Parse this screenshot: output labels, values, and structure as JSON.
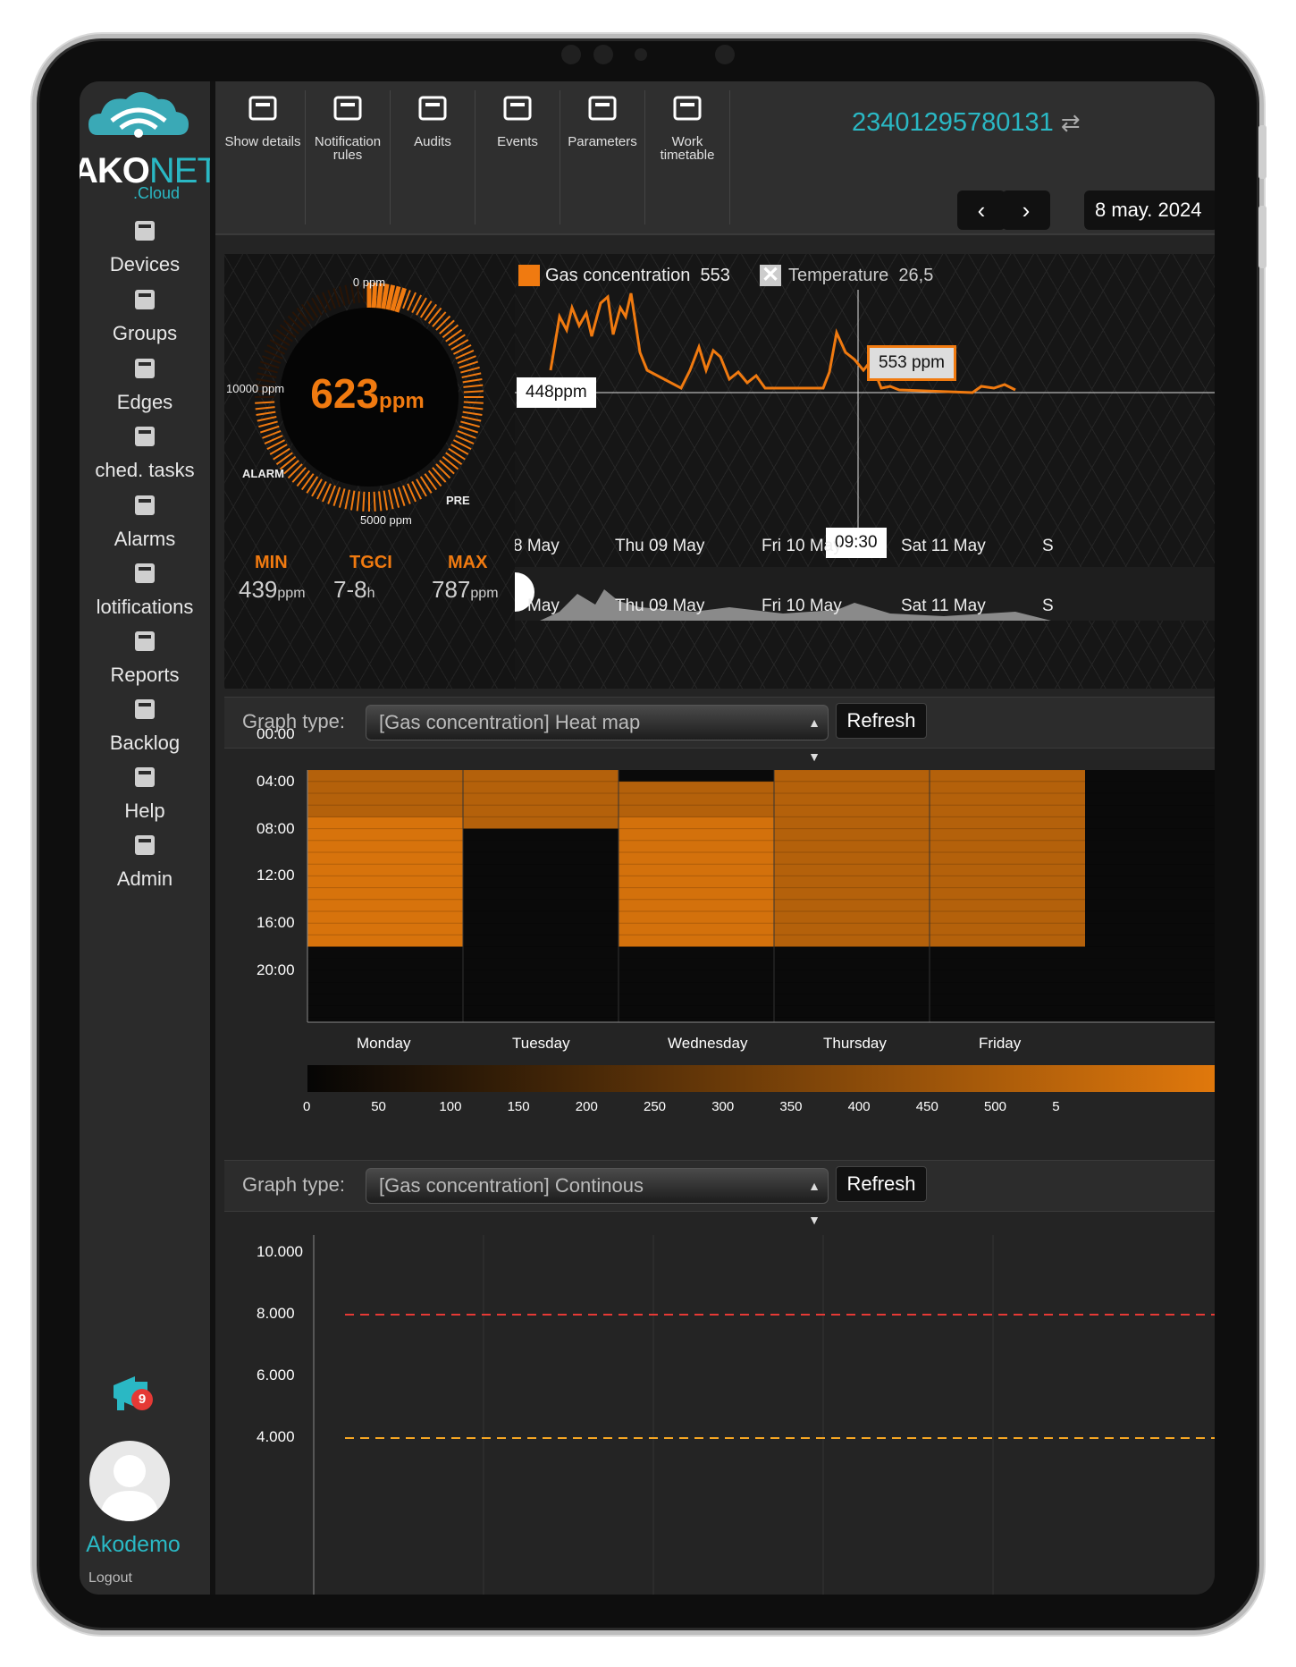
{
  "brand": {
    "name_a": "AKO",
    "name_b": "NET",
    "suffix": ".Cloud"
  },
  "sidebar": {
    "items": [
      {
        "label": "Devices",
        "icon": "cube-icon"
      },
      {
        "label": "Groups",
        "icon": "cubes-icon"
      },
      {
        "label": "Edges",
        "icon": "edge-box-icon"
      },
      {
        "label": "ched. tasks",
        "icon": "task-list-icon"
      },
      {
        "label": "Alarms",
        "icon": "bell-icon"
      },
      {
        "label": "lotifications",
        "icon": "envelope-icon"
      },
      {
        "label": "Reports",
        "icon": "document-icon"
      },
      {
        "label": "Backlog",
        "icon": "gears-icon"
      },
      {
        "label": "Help",
        "icon": "lifebuoy-icon"
      },
      {
        "label": "Admin",
        "icon": "user-gear-icon"
      }
    ],
    "promo_badge": "9",
    "username": "Akodemo",
    "logout": "Logout"
  },
  "toolbar": {
    "tools": [
      {
        "label": "Show details",
        "icon": "details-panel-icon"
      },
      {
        "label": "Notification rules",
        "icon": "envelope-icon"
      },
      {
        "label": "Audits",
        "icon": "magnifier-user-icon"
      },
      {
        "label": "Events",
        "icon": "calendar-clock-icon"
      },
      {
        "label": "Parameters",
        "icon": "gear-icon"
      },
      {
        "label": "Work timetable",
        "icon": "alert-calendar-icon"
      }
    ],
    "device_id": "23401295780131",
    "date": "8 may. 2024"
  },
  "gauge": {
    "value": "623",
    "unit": "ppm",
    "value_num": 623,
    "label_top": "0 ppm",
    "label_left": "10000 ppm",
    "label_bottom": "5000 ppm",
    "label_alarm": "ALARM",
    "label_pre": "PRE",
    "stats": [
      {
        "label": "MIN",
        "value": "439",
        "unit": "ppm"
      },
      {
        "label": "TGCI",
        "value": "7-8",
        "unit": "h"
      },
      {
        "label": "MAX",
        "value": "787",
        "unit": "ppm"
      }
    ]
  },
  "line_chart": {
    "legend": [
      {
        "name": "Gas concentration",
        "value": "553",
        "color": "#f07a10",
        "enabled": true
      },
      {
        "name": "Temperature",
        "value": "26,5",
        "color": "#ffffff",
        "enabled": false
      }
    ],
    "x_labels": [
      "8 May",
      "Thu 09 May",
      "Fri 10 May",
      "Sat 11 May",
      "S"
    ],
    "nav_labels": [
      "May",
      "Thu 09 May",
      "Fri 10 May",
      "Sat 11 May",
      "S"
    ],
    "tooltip_value": "553 ppm",
    "crosshair_y_label": "448ppm",
    "crosshair_x_label": "09:30"
  },
  "heatmap_section": {
    "graph_type_label": "Graph type:",
    "selected": "[Gas concentration] Heat map",
    "refresh": "Refresh",
    "y_ticks": [
      "00:00",
      "04:00",
      "08:00",
      "12:00",
      "16:00",
      "20:00"
    ],
    "days": [
      "Monday",
      "Tuesday",
      "Wednesday",
      "Thursday",
      "Friday"
    ],
    "scale_ticks": [
      "0",
      "50",
      "100",
      "150",
      "200",
      "250",
      "300",
      "350",
      "400",
      "450",
      "500",
      "5"
    ]
  },
  "continuous_section": {
    "graph_type_label": "Graph type:",
    "selected": "[Gas concentration] Continous",
    "refresh": "Refresh",
    "y_ticks": [
      "10.000",
      "8.000",
      "6.000",
      "4.000"
    ],
    "alarm_color": "#e53935",
    "pre_color": "#f5a623"
  },
  "chart_data": [
    {
      "type": "heatmap",
      "title": "",
      "xlabel": "",
      "ylabel": "",
      "x": [
        "Monday",
        "Tuesday",
        "Wednesday",
        "Thursday",
        "Friday"
      ],
      "y": [
        "00:00",
        "04:00",
        "08:00",
        "12:00",
        "16:00",
        "20:00"
      ],
      "colorscale_range": [
        0,
        500
      ],
      "approx_values": [
        {
          "day": "Monday",
          "from": "03:00",
          "to": "07:00",
          "value": 400
        },
        {
          "day": "Monday",
          "from": "07:00",
          "to": "18:00",
          "value": 480
        },
        {
          "day": "Tuesday",
          "from": "03:00",
          "to": "08:00",
          "value": 400
        },
        {
          "day": "Wednesday",
          "from": "04:00",
          "to": "07:00",
          "value": 400
        },
        {
          "day": "Wednesday",
          "from": "07:00",
          "to": "18:00",
          "value": 470
        },
        {
          "day": "Thursday",
          "from": "03:00",
          "to": "18:00",
          "value": 400
        },
        {
          "day": "Friday",
          "from": "03:00",
          "to": "18:00",
          "value": 400
        }
      ]
    },
    {
      "type": "line",
      "title": "",
      "xlabel": "",
      "ylabel": "",
      "y_ticks": [
        10000,
        8000,
        6000,
        4000
      ],
      "ylim": [
        4000,
        10000
      ],
      "thresholds": [
        {
          "label": "ALARM",
          "value": 8000
        },
        {
          "label": "PRE",
          "value": 5000
        }
      ]
    }
  ]
}
